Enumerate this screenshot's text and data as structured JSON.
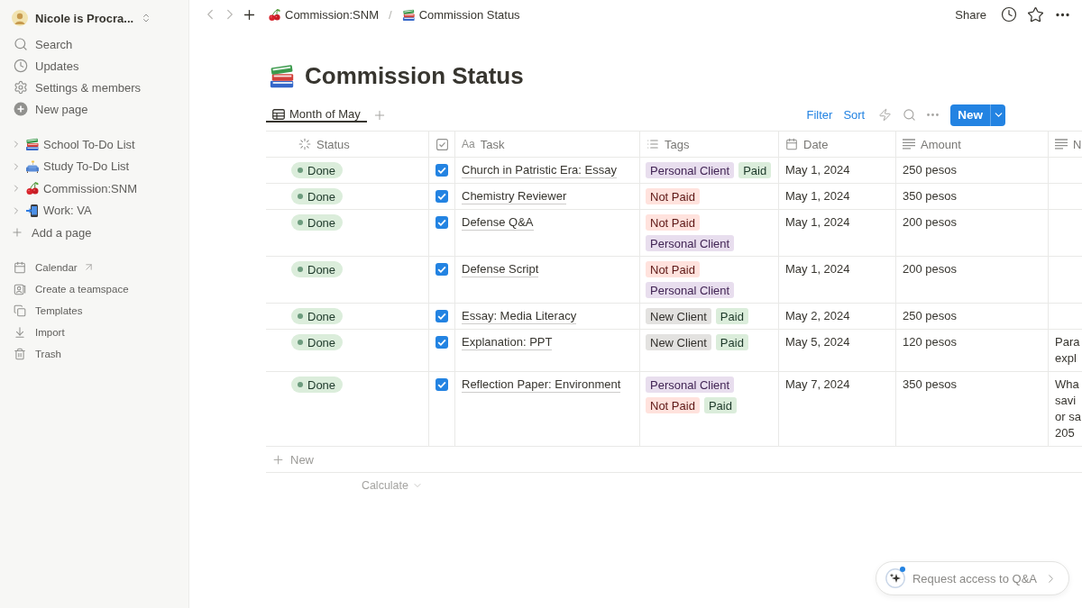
{
  "sidebar": {
    "workspace": {
      "name": "Nicole is Procra..."
    },
    "nav": [
      {
        "label": "Search"
      },
      {
        "label": "Updates"
      },
      {
        "label": "Settings & members"
      },
      {
        "label": "New page"
      }
    ],
    "pages": [
      {
        "label": "School To-Do List",
        "expanded": false
      },
      {
        "label": "Study To-Do List",
        "expanded": false
      },
      {
        "label": "Commission:SNM",
        "expanded": false
      },
      {
        "label": "Work: VA",
        "expanded": false
      }
    ],
    "add_page": "Add a page",
    "footer": [
      {
        "label": "Calendar",
        "external": true
      },
      {
        "label": "Create a teamspace",
        "external": false
      },
      {
        "label": "Templates",
        "external": false
      },
      {
        "label": "Import",
        "external": false
      },
      {
        "label": "Trash",
        "external": false
      }
    ]
  },
  "topbar": {
    "breadcrumbs": [
      {
        "label": "Commission:SNM"
      },
      {
        "label": "Commission Status"
      }
    ],
    "separator": "/",
    "share": "Share"
  },
  "page": {
    "title": "Commission Status"
  },
  "views": [
    {
      "label": "Month of May",
      "selected": true
    }
  ],
  "toolbar": {
    "filter": "Filter",
    "sort": "Sort",
    "new": "New"
  },
  "table": {
    "columns": [
      {
        "kind": "status",
        "label": "Status"
      },
      {
        "kind": "checkbox"
      },
      {
        "kind": "title",
        "prefix": "Aa",
        "label": "Task"
      },
      {
        "kind": "multi_select",
        "label": "Tags"
      },
      {
        "kind": "date",
        "label": "Date"
      },
      {
        "kind": "text",
        "label": "Amount"
      },
      {
        "kind": "text",
        "label": "N"
      }
    ],
    "rows": [
      {
        "status": "Done",
        "checked": true,
        "task": "Church in Patristic Era: Essay",
        "tags": [
          {
            "label": "Personal Client",
            "color": "#e8deee"
          },
          {
            "label": "Paid",
            "color": "#dbeddb"
          }
        ],
        "date": "May 1, 2024",
        "amount": "250 pesos"
      },
      {
        "status": "Done",
        "checked": true,
        "task": "Chemistry Reviewer",
        "tags": [
          {
            "label": "Not Paid",
            "color": "#ffe2dd"
          }
        ],
        "date": "May 1, 2024",
        "amount": "350 pesos"
      },
      {
        "status": "Done",
        "checked": true,
        "task": "Defense Q&A",
        "tags": [
          {
            "label": "Not Paid",
            "color": "#ffe2dd"
          },
          {
            "label": "Personal Client",
            "color": "#e8deee"
          }
        ],
        "date": "May 1, 2024",
        "amount": "200 pesos"
      },
      {
        "status": "Done",
        "checked": true,
        "task": "Defense Script",
        "tags": [
          {
            "label": "Not Paid",
            "color": "#ffe2dd"
          },
          {
            "label": "Personal Client",
            "color": "#e8deee"
          }
        ],
        "date": "May 1, 2024",
        "amount": "200 pesos"
      },
      {
        "status": "Done",
        "checked": true,
        "task": "Essay: Media Literacy",
        "tags": [
          {
            "label": "New Client",
            "color": "#e3e2e0"
          },
          {
            "label": "Paid",
            "color": "#dbeddb"
          }
        ],
        "date": "May 2, 2024",
        "amount": "250 pesos"
      },
      {
        "status": "Done",
        "checked": true,
        "task": "Explanation: PPT",
        "tags": [
          {
            "label": "New Client",
            "color": "#e3e2e0"
          },
          {
            "label": "Paid",
            "color": "#dbeddb"
          }
        ],
        "date": "May 5, 2024",
        "amount": "120 pesos",
        "column_7": [
          "Para",
          "expl"
        ]
      },
      {
        "status": "Done",
        "checked": true,
        "task": "Reflection Paper: Environment",
        "tags": [
          {
            "label": "Personal Client",
            "color": "#e8deee"
          },
          {
            "label": "Not Paid",
            "color": "#ffe2dd"
          },
          {
            "label": "Paid",
            "color": "#dbeddb"
          }
        ],
        "date": "May 7, 2024",
        "amount": "350 pesos",
        "column_7": [
          "Wha",
          "savi",
          "or sa",
          "205"
        ]
      }
    ],
    "add_row": "New",
    "calculate": "Calculate"
  },
  "qa_button": {
    "label": "Request access to Q&A",
    "notification": true
  }
}
